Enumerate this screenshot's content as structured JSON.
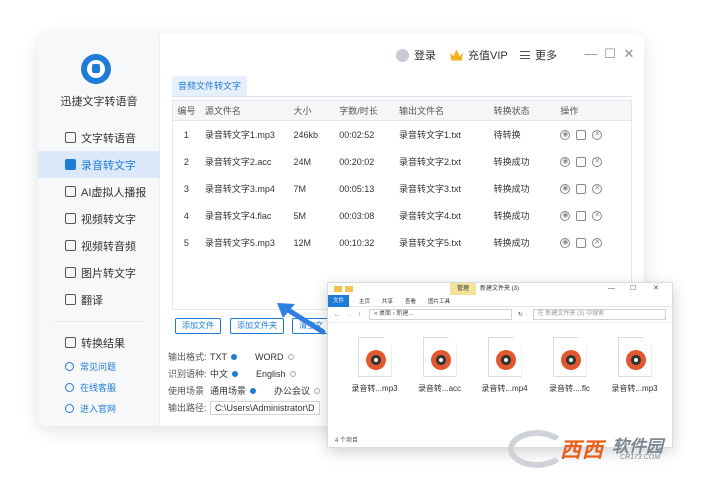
{
  "app": {
    "name": "迅捷文字转语音",
    "top_login": "登录",
    "top_vip": "充值VIP",
    "top_more": "更多"
  },
  "sidebar": {
    "items": [
      {
        "label": "文字转语音"
      },
      {
        "label": "录音转文字"
      },
      {
        "label": "AI虚拟人播报"
      },
      {
        "label": "视频转文字"
      },
      {
        "label": "视频转音频"
      },
      {
        "label": "图片转文字"
      },
      {
        "label": "翻译"
      }
    ],
    "results_label": "转换结果",
    "help": [
      {
        "label": "常见问题"
      },
      {
        "label": "在线客服"
      },
      {
        "label": "进入官网"
      }
    ]
  },
  "tab": {
    "label": "音频文件转文字"
  },
  "table": {
    "headers": [
      "编号",
      "源文件名",
      "大小",
      "字数/时长",
      "输出文件名",
      "转换状态",
      "操作"
    ],
    "rows": [
      [
        "1",
        "录音转文字1.mp3",
        "246kb",
        "00:02:52",
        "录音转文字1.txt",
        "待转换"
      ],
      [
        "2",
        "录音转文字2.acc",
        "24M",
        "00:20:02",
        "录音转文字2.txt",
        "转换成功"
      ],
      [
        "3",
        "录音转文字3.mp4",
        "7M",
        "00:05:13",
        "录音转文字3.txt",
        "转换成功"
      ],
      [
        "4",
        "录音转文字4.flac",
        "5M",
        "00:03:08",
        "录音转文字4.txt",
        "转换成功"
      ],
      [
        "5",
        "录音转文字5.mp3",
        "12M",
        "00:10:32",
        "录音转文字5.txt",
        "转换成功"
      ]
    ]
  },
  "buttons": {
    "add_file": "添加文件",
    "add_folder": "添加文件夹",
    "clear": "清空文"
  },
  "options": {
    "format_label": "输出格式:",
    "format_a": "TXT",
    "format_b": "WORD",
    "lang_label": "识别语种:",
    "lang_a": "中文",
    "lang_b": "English",
    "scene_label": "使用场景",
    "scene_a": "通用场景",
    "scene_b": "办公会议",
    "path_label": "输出路径:",
    "path_value": "C:\\Users\\Administrator\\D"
  },
  "explorer": {
    "manage": "管理",
    "folder_name": "新建文件夹 (3)",
    "ribbon_file": "文件",
    "ribbon_home": "主页",
    "ribbon_share": "共享",
    "ribbon_view": "查看",
    "ribbon_tools": "图片工具",
    "path": "« 桌面 › 新建...",
    "search_placeholder": "在 新建文件夹 (3) 中搜索",
    "files": [
      {
        "name": "录音转...mp3"
      },
      {
        "name": "录音转...acc"
      },
      {
        "name": "录音转...mp4"
      },
      {
        "name": "录音转....flc"
      },
      {
        "name": "录音转...mp3"
      }
    ],
    "status": "4 个项目"
  },
  "watermark": {
    "main": "西西",
    "soft": "软件园",
    "domain": "CR173.COM"
  },
  "colors": {
    "accent": "#1e7cd8",
    "vip": "#f5b31a",
    "watermark": "#e85f1a"
  }
}
